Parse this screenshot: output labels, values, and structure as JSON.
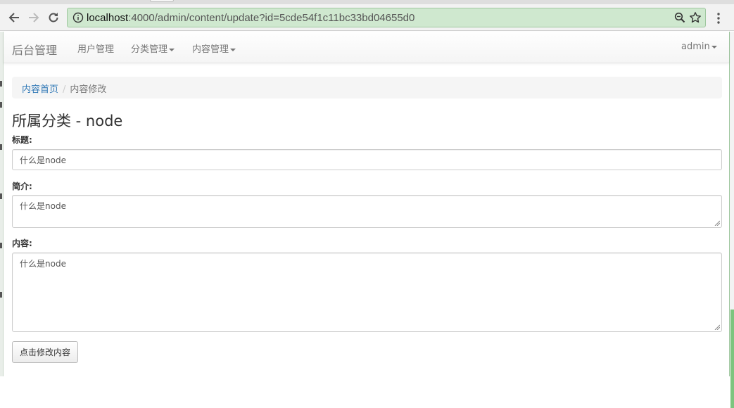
{
  "browser": {
    "url_host": "localhost",
    "url_path": ":4000/admin/content/update?id=5cde54f1c11bc33bd04655d0"
  },
  "navbar": {
    "brand": "后台管理",
    "items": [
      {
        "label": "用户管理"
      },
      {
        "label": "分类管理"
      },
      {
        "label": "内容管理"
      }
    ],
    "user": "admin"
  },
  "breadcrumb": {
    "home": "内容首页",
    "current": "内容修改"
  },
  "form": {
    "heading": "所属分类 - node",
    "title_label": "标题:",
    "title_value": "什么是node",
    "summary_label": "简介:",
    "summary_value": "什么是node",
    "content_label": "内容:",
    "content_value": "什么是node",
    "submit_label": "点击修改内容"
  }
}
